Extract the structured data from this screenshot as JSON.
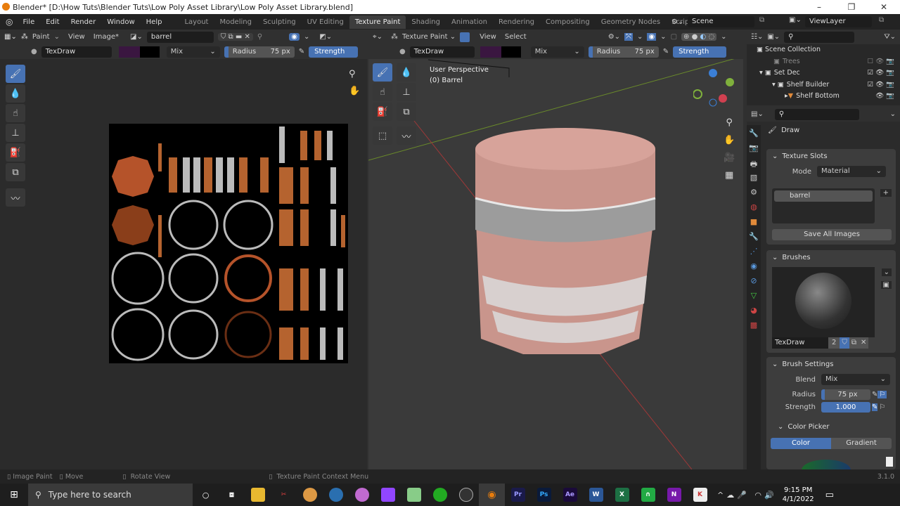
{
  "window": {
    "title": "Blender* [D:\\How Tuts\\Blender Tuts\\Low Poly Asset Library\\Low Poly Asset Library.blend]",
    "min": "–",
    "max": "❐",
    "close": "✕"
  },
  "menu": [
    "File",
    "Edit",
    "Render",
    "Window",
    "Help"
  ],
  "workspaces": [
    "Layout",
    "Modeling",
    "Sculpting",
    "UV Editing",
    "Texture Paint",
    "Shading",
    "Animation",
    "Rendering",
    "Compositing",
    "Geometry Nodes",
    "Scripting",
    "+"
  ],
  "scene": {
    "name": "Scene",
    "view_layer": "ViewLayer"
  },
  "image_editor": {
    "mode": "Paint",
    "view": "View",
    "image_menu": "Image*",
    "image_name": "barrel",
    "brush": "TexDraw",
    "blend": "Mix",
    "radius_label": "Radius",
    "radius": "75 px",
    "strength_label": "Strength"
  },
  "viewport": {
    "mode": "Texture Paint",
    "view": "View",
    "select": "Select",
    "brush": "TexDraw",
    "blend": "Mix",
    "radius_label": "Radius",
    "radius": "75 px",
    "strength_label": "Strength",
    "overlay_line1": "User Perspective",
    "overlay_line2": "(0) Barrel"
  },
  "outliner": {
    "root": "Scene Collection",
    "items": [
      {
        "name": "Trees"
      },
      {
        "name": "Set Dec"
      },
      {
        "name": "Shelf Builder"
      },
      {
        "name": "Shelf Bottom"
      }
    ]
  },
  "properties": {
    "tool": "Draw",
    "texture_slots": {
      "title": "Texture Slots",
      "mode_label": "Mode",
      "mode": "Material",
      "slot": "barrel",
      "save": "Save All Images"
    },
    "brushes": {
      "title": "Brushes",
      "name": "TexDraw",
      "users": "2"
    },
    "brush_settings": {
      "title": "Brush Settings",
      "blend_label": "Blend",
      "blend": "Mix",
      "radius_label": "Radius",
      "radius": "75 px",
      "strength_label": "Strength",
      "strength": "1.000",
      "strength_fraction": 1.0
    },
    "color_picker": {
      "title": "Color Picker",
      "tab_color": "Color",
      "tab_gradient": "Gradient"
    }
  },
  "status": {
    "image_paint": "Image Paint",
    "move": "Move",
    "rotate": "Rotate View",
    "context": "Texture Paint Context Menu",
    "version": "3.1.0"
  },
  "taskbar": {
    "search": "Type here to search",
    "time": "9:15 PM",
    "date": "4/1/2022",
    "apps": [
      "Pr",
      "Ps",
      "Ae",
      "W",
      "X",
      "N"
    ]
  },
  "colors": {
    "accent": "#4772b3",
    "paint_color": "#3a1640",
    "barrel": "#d59a90"
  }
}
